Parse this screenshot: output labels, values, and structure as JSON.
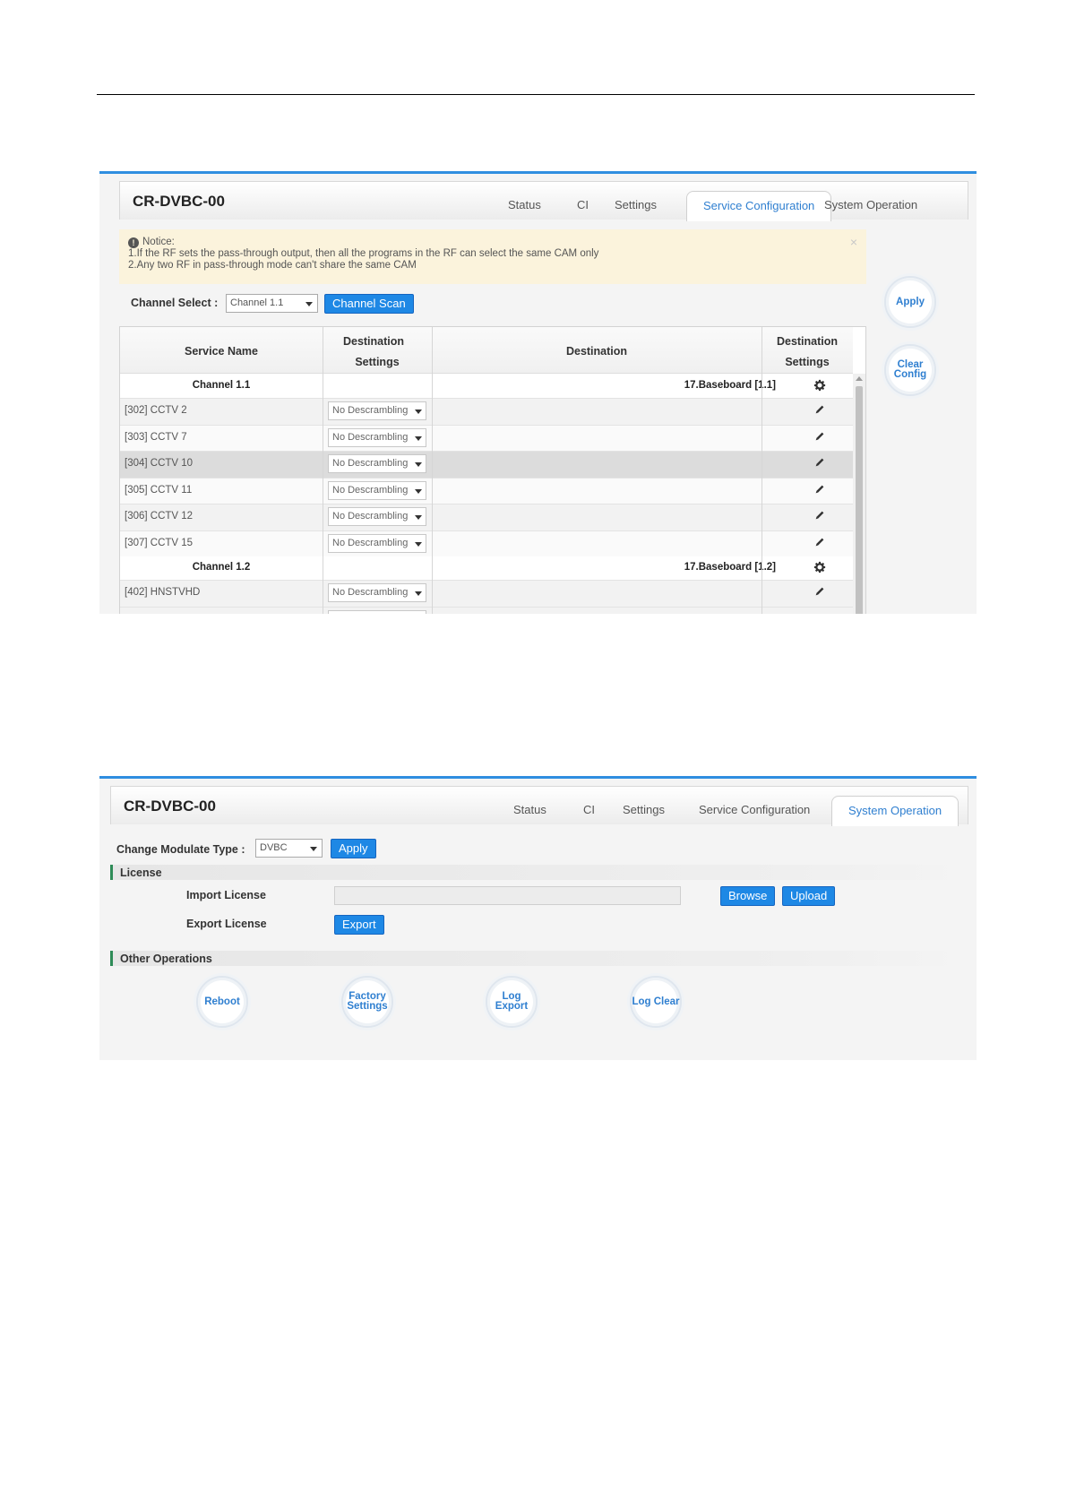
{
  "shot1": {
    "brand": "CR-DVBC-00",
    "tabs": [
      "Status",
      "CI",
      "Settings",
      "Service Configuration",
      "System Operation"
    ],
    "active_tab": "Service Configuration",
    "notice": {
      "title": "Notice:",
      "line1": "1.If the RF sets the pass-through output, then all the programs in the RF can select the same CAM only",
      "line2": "2.Any two RF in pass-through mode can't share the same CAM",
      "close": "×"
    },
    "channel_select_label": "Channel Select :",
    "channel_select_value": "Channel 1.1",
    "channel_scan_label": "Channel Scan",
    "apply_label": "Apply",
    "clear_config_line1": "Clear",
    "clear_config_line2": "Config",
    "table": {
      "col_service_name": "Service Name",
      "col_dest_settings_1": "Destination",
      "col_dest_settings_2": "Settings",
      "col_destination": "Destination",
      "col_dest_settings_b1": "Destination",
      "col_dest_settings_b2": "Settings",
      "groups": [
        {
          "channel": "Channel 1.1",
          "destination": "17.Baseboard [1.1]",
          "services": [
            {
              "name": "[302] CCTV 2",
              "setting": "No Descrambling"
            },
            {
              "name": "[303] CCTV 7",
              "setting": "No Descrambling"
            },
            {
              "name": "[304] CCTV 10",
              "setting": "No Descrambling"
            },
            {
              "name": "[305] CCTV 11",
              "setting": "No Descrambling"
            },
            {
              "name": "[306] CCTV 12",
              "setting": "No Descrambling"
            },
            {
              "name": "[307] CCTV 15",
              "setting": "No Descrambling"
            }
          ]
        },
        {
          "channel": "Channel 1.2",
          "destination": "17.Baseboard [1.2]",
          "services": [
            {
              "name": "[402] HNSTVHD",
              "setting": "No Descrambling"
            }
          ]
        }
      ]
    }
  },
  "shot2": {
    "brand": "CR-DVBC-00",
    "tabs": [
      "Status",
      "CI",
      "Settings",
      "Service Configuration",
      "System Operation"
    ],
    "active_tab": "System Operation",
    "change_modulate_label": "Change Modulate Type :",
    "modulate_value": "DVBC",
    "apply_label": "Apply",
    "license_section": "License",
    "import_license_label": "Import License",
    "export_license_label": "Export License",
    "browse_label": "Browse",
    "upload_label": "Upload",
    "export_label": "Export",
    "other_section": "Other Operations",
    "ops": {
      "reboot": "Reboot",
      "factory_1": "Factory",
      "factory_2": "Settings",
      "log_export": "Log Export",
      "log_clear": "Log Clear"
    }
  },
  "colors": {
    "accent": "#1e88e5",
    "tab_active_text": "#2f7fd0",
    "section_marker": "#2e8b57",
    "notice_bg": "#fbf3dc"
  }
}
